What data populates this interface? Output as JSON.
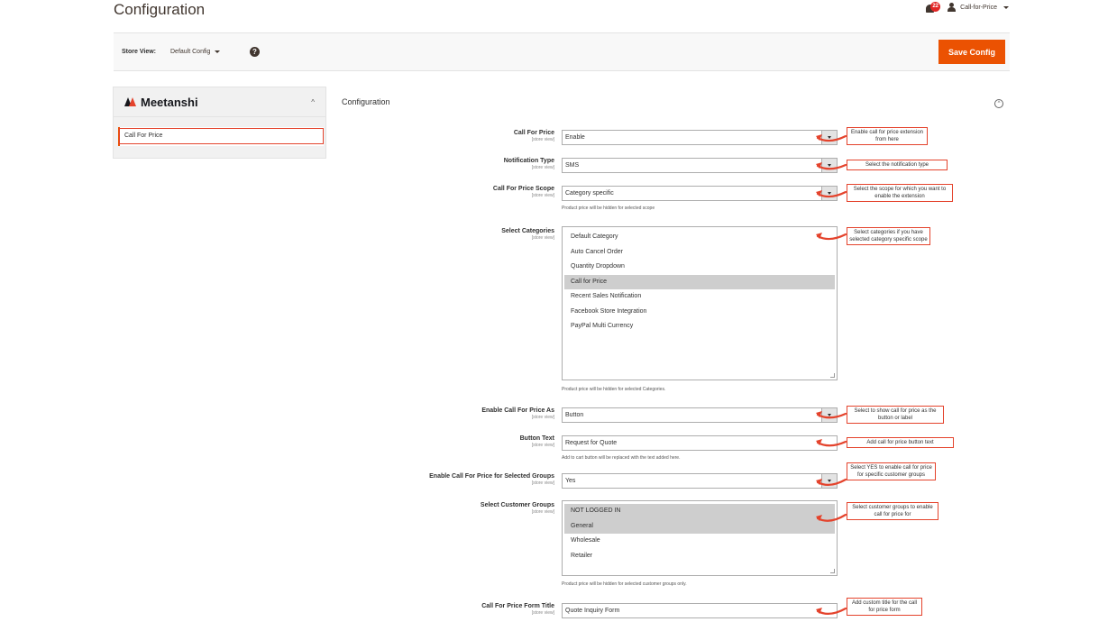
{
  "header": {
    "title": "Configuration",
    "notification_count": "22",
    "user_name": "Call-for-Price"
  },
  "store_view": {
    "label": "Store View:",
    "value": "Default Config"
  },
  "toolbar": {
    "save_label": "Save Config"
  },
  "sidebar": {
    "brand": "Meetanshi",
    "items": [
      {
        "label": "Call For Price"
      }
    ]
  },
  "main": {
    "section_title": "Configuration",
    "scope_text": "[store view]",
    "fields": {
      "call_for_price": {
        "label": "Call For Price",
        "value": "Enable"
      },
      "notification_type": {
        "label": "Notification Type",
        "value": "SMS"
      },
      "scope": {
        "label": "Call For Price Scope",
        "value": "Category specific",
        "note": "Product price will be hidden for selected scope"
      },
      "categories": {
        "label": "Select Categories",
        "options": [
          "Default Category",
          "Auto Cancel Order",
          "Quantity Dropdown",
          "Call for Price",
          "Recent Sales Notification",
          "Facebook Store Integration",
          "PayPal Multi Currency"
        ],
        "selected": [
          "Call for Price"
        ],
        "note": "Product price will be hidden for selected Categories."
      },
      "enable_as": {
        "label": "Enable Call For Price As",
        "value": "Button"
      },
      "button_text": {
        "label": "Button Text",
        "value": "Request for Quote",
        "note": "Add to cart button will be replaced with the text added here."
      },
      "enable_groups": {
        "label": "Enable Call For Price for Selected Groups",
        "value": "Yes"
      },
      "customer_groups": {
        "label": "Select Customer Groups",
        "options": [
          "NOT LOGGED IN",
          "General",
          "Wholesale",
          "Retailer"
        ],
        "selected": [
          "NOT LOGGED IN",
          "General"
        ],
        "note": "Product price will be hidden for selected customer groups only."
      },
      "form_title": {
        "label": "Call For Price Form Title",
        "value": "Quote Inquiry Form"
      }
    }
  },
  "callouts": {
    "c1": "Enable call for price extension from here",
    "c2": "Select the notification type",
    "c3": "Select the scope for which you want to enable the extension",
    "c4": "Select categories if you have selected category specific scope",
    "c5": "Select to show call for price as the button or label",
    "c6": "Add call for price button text",
    "c7": "Select YES to enable call for price for specific customer groups",
    "c8": "Select customer groups to enable call for price for",
    "c9": "Add custom title for the call for price form"
  },
  "colors": {
    "accent": "#eb5202",
    "annotation": "#e4432c",
    "selected_option": "#cecece"
  }
}
